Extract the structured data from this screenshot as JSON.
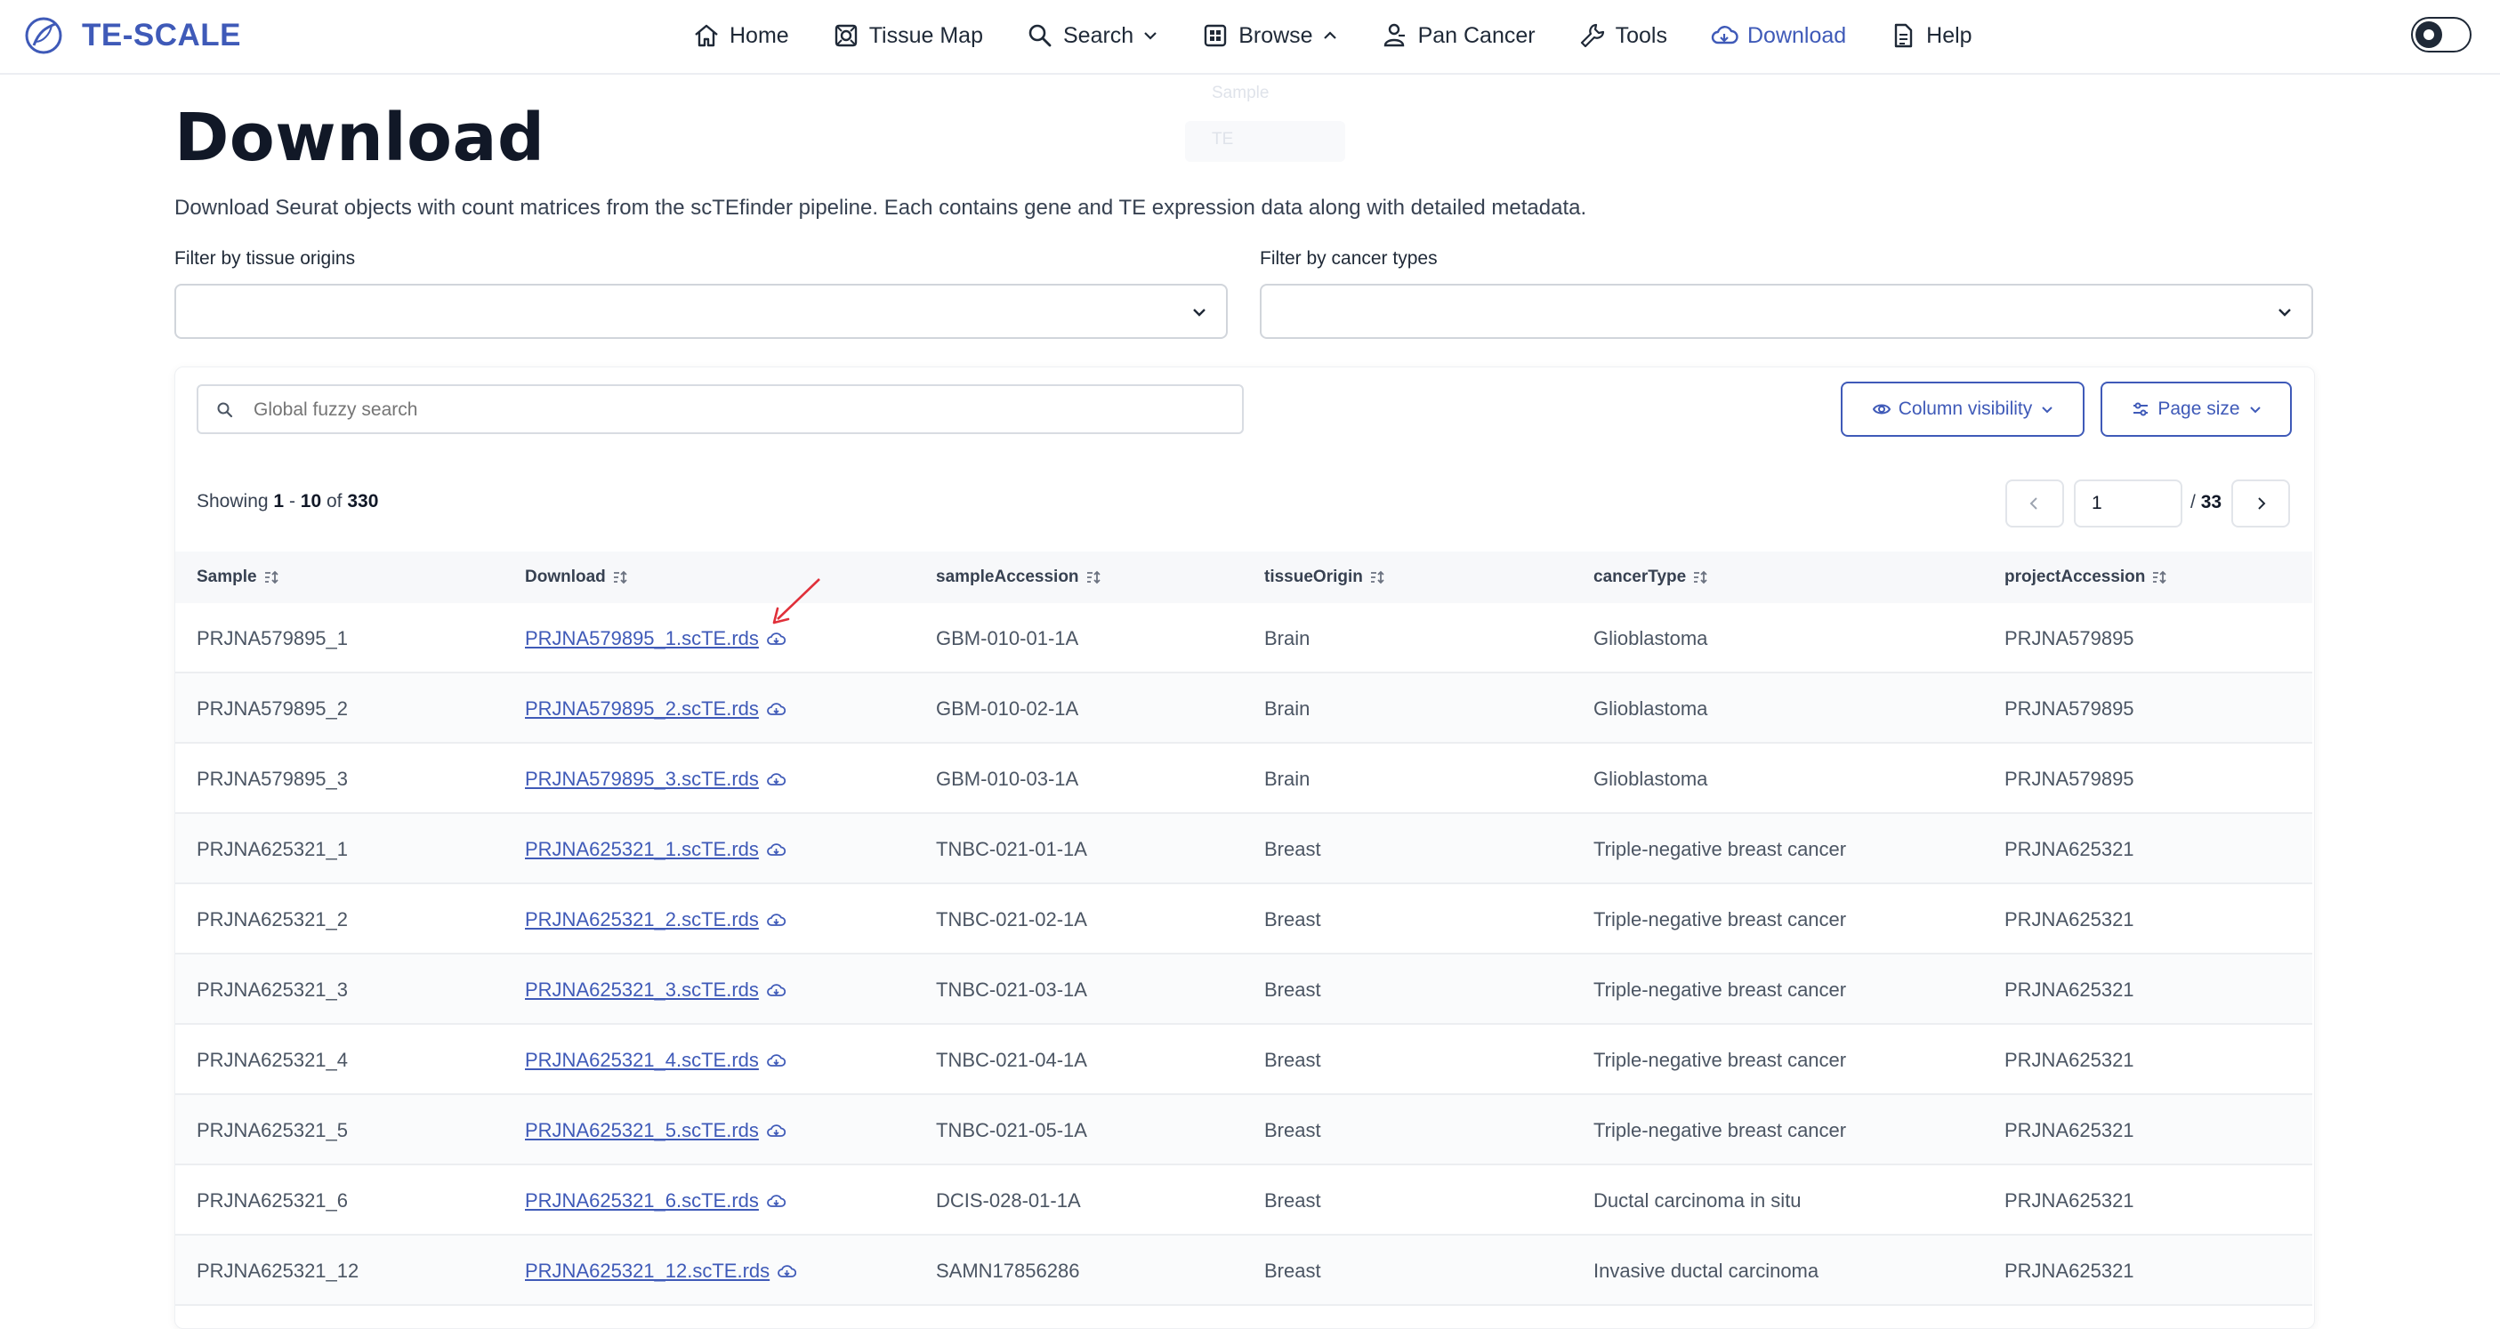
{
  "brand": {
    "name": "TE-SCALE"
  },
  "nav": {
    "items": [
      {
        "label": "Home",
        "icon": "home-icon"
      },
      {
        "label": "Tissue Map",
        "icon": "tissue-map-icon"
      },
      {
        "label": "Search",
        "icon": "search-icon",
        "chevron": "down"
      },
      {
        "label": "Browse",
        "icon": "grid-icon",
        "chevron": "up"
      },
      {
        "label": "Pan Cancer",
        "icon": "person-icon"
      },
      {
        "label": "Tools",
        "icon": "wrench-icon"
      },
      {
        "label": "Download",
        "icon": "cloud-download-icon",
        "active": true
      },
      {
        "label": "Help",
        "icon": "document-icon"
      }
    ],
    "browse_menu_ghost": [
      "Sample",
      "TE"
    ]
  },
  "page": {
    "title": "Download",
    "description": "Download Seurat objects with count matrices from the scTEfinder pipeline. Each contains gene and TE expression data along with detailed metadata."
  },
  "filters": {
    "tissue_label": "Filter by tissue origins",
    "cancer_label": "Filter by cancer types"
  },
  "toolbar": {
    "search_placeholder": "Global fuzzy search",
    "column_visibility_label": "Column visibility",
    "page_size_label": "Page size"
  },
  "pagination": {
    "showing_prefix": "Showing",
    "from": "1",
    "dash": "-",
    "to": "10",
    "of_word": "of",
    "total": "330",
    "current_page": "1",
    "slash": "/",
    "total_pages": "33"
  },
  "table": {
    "columns": [
      "Sample",
      "Download",
      "sampleAccession",
      "tissueOrigin",
      "cancerType",
      "projectAccession"
    ],
    "rows": [
      {
        "sample": "PRJNA579895_1",
        "download": "PRJNA579895_1.scTE.rds",
        "sampleAccession": "GBM-010-01-1A",
        "tissueOrigin": "Brain",
        "cancerType": "Glioblastoma",
        "projectAccession": "PRJNA579895"
      },
      {
        "sample": "PRJNA579895_2",
        "download": "PRJNA579895_2.scTE.rds",
        "sampleAccession": "GBM-010-02-1A",
        "tissueOrigin": "Brain",
        "cancerType": "Glioblastoma",
        "projectAccession": "PRJNA579895"
      },
      {
        "sample": "PRJNA579895_3",
        "download": "PRJNA579895_3.scTE.rds",
        "sampleAccession": "GBM-010-03-1A",
        "tissueOrigin": "Brain",
        "cancerType": "Glioblastoma",
        "projectAccession": "PRJNA579895"
      },
      {
        "sample": "PRJNA625321_1",
        "download": "PRJNA625321_1.scTE.rds",
        "sampleAccession": "TNBC-021-01-1A",
        "tissueOrigin": "Breast",
        "cancerType": "Triple-negative breast cancer",
        "projectAccession": "PRJNA625321"
      },
      {
        "sample": "PRJNA625321_2",
        "download": "PRJNA625321_2.scTE.rds",
        "sampleAccession": "TNBC-021-02-1A",
        "tissueOrigin": "Breast",
        "cancerType": "Triple-negative breast cancer",
        "projectAccession": "PRJNA625321"
      },
      {
        "sample": "PRJNA625321_3",
        "download": "PRJNA625321_3.scTE.rds",
        "sampleAccession": "TNBC-021-03-1A",
        "tissueOrigin": "Breast",
        "cancerType": "Triple-negative breast cancer",
        "projectAccession": "PRJNA625321"
      },
      {
        "sample": "PRJNA625321_4",
        "download": "PRJNA625321_4.scTE.rds",
        "sampleAccession": "TNBC-021-04-1A",
        "tissueOrigin": "Breast",
        "cancerType": "Triple-negative breast cancer",
        "projectAccession": "PRJNA625321"
      },
      {
        "sample": "PRJNA625321_5",
        "download": "PRJNA625321_5.scTE.rds",
        "sampleAccession": "TNBC-021-05-1A",
        "tissueOrigin": "Breast",
        "cancerType": "Triple-negative breast cancer",
        "projectAccession": "PRJNA625321"
      },
      {
        "sample": "PRJNA625321_6",
        "download": "PRJNA625321_6.scTE.rds",
        "sampleAccession": "DCIS-028-01-1A",
        "tissueOrigin": "Breast",
        "cancerType": "Ductal carcinoma in situ",
        "projectAccession": "PRJNA625321"
      },
      {
        "sample": "PRJNA625321_12",
        "download": "PRJNA625321_12.scTE.rds",
        "sampleAccession": "SAMN17856286",
        "tissueOrigin": "Breast",
        "cancerType": "Invasive ductal carcinoma",
        "projectAccession": "PRJNA625321"
      }
    ]
  },
  "colors": {
    "brand": "#3f5ab8",
    "annotation_arrow": "#e0303a"
  }
}
